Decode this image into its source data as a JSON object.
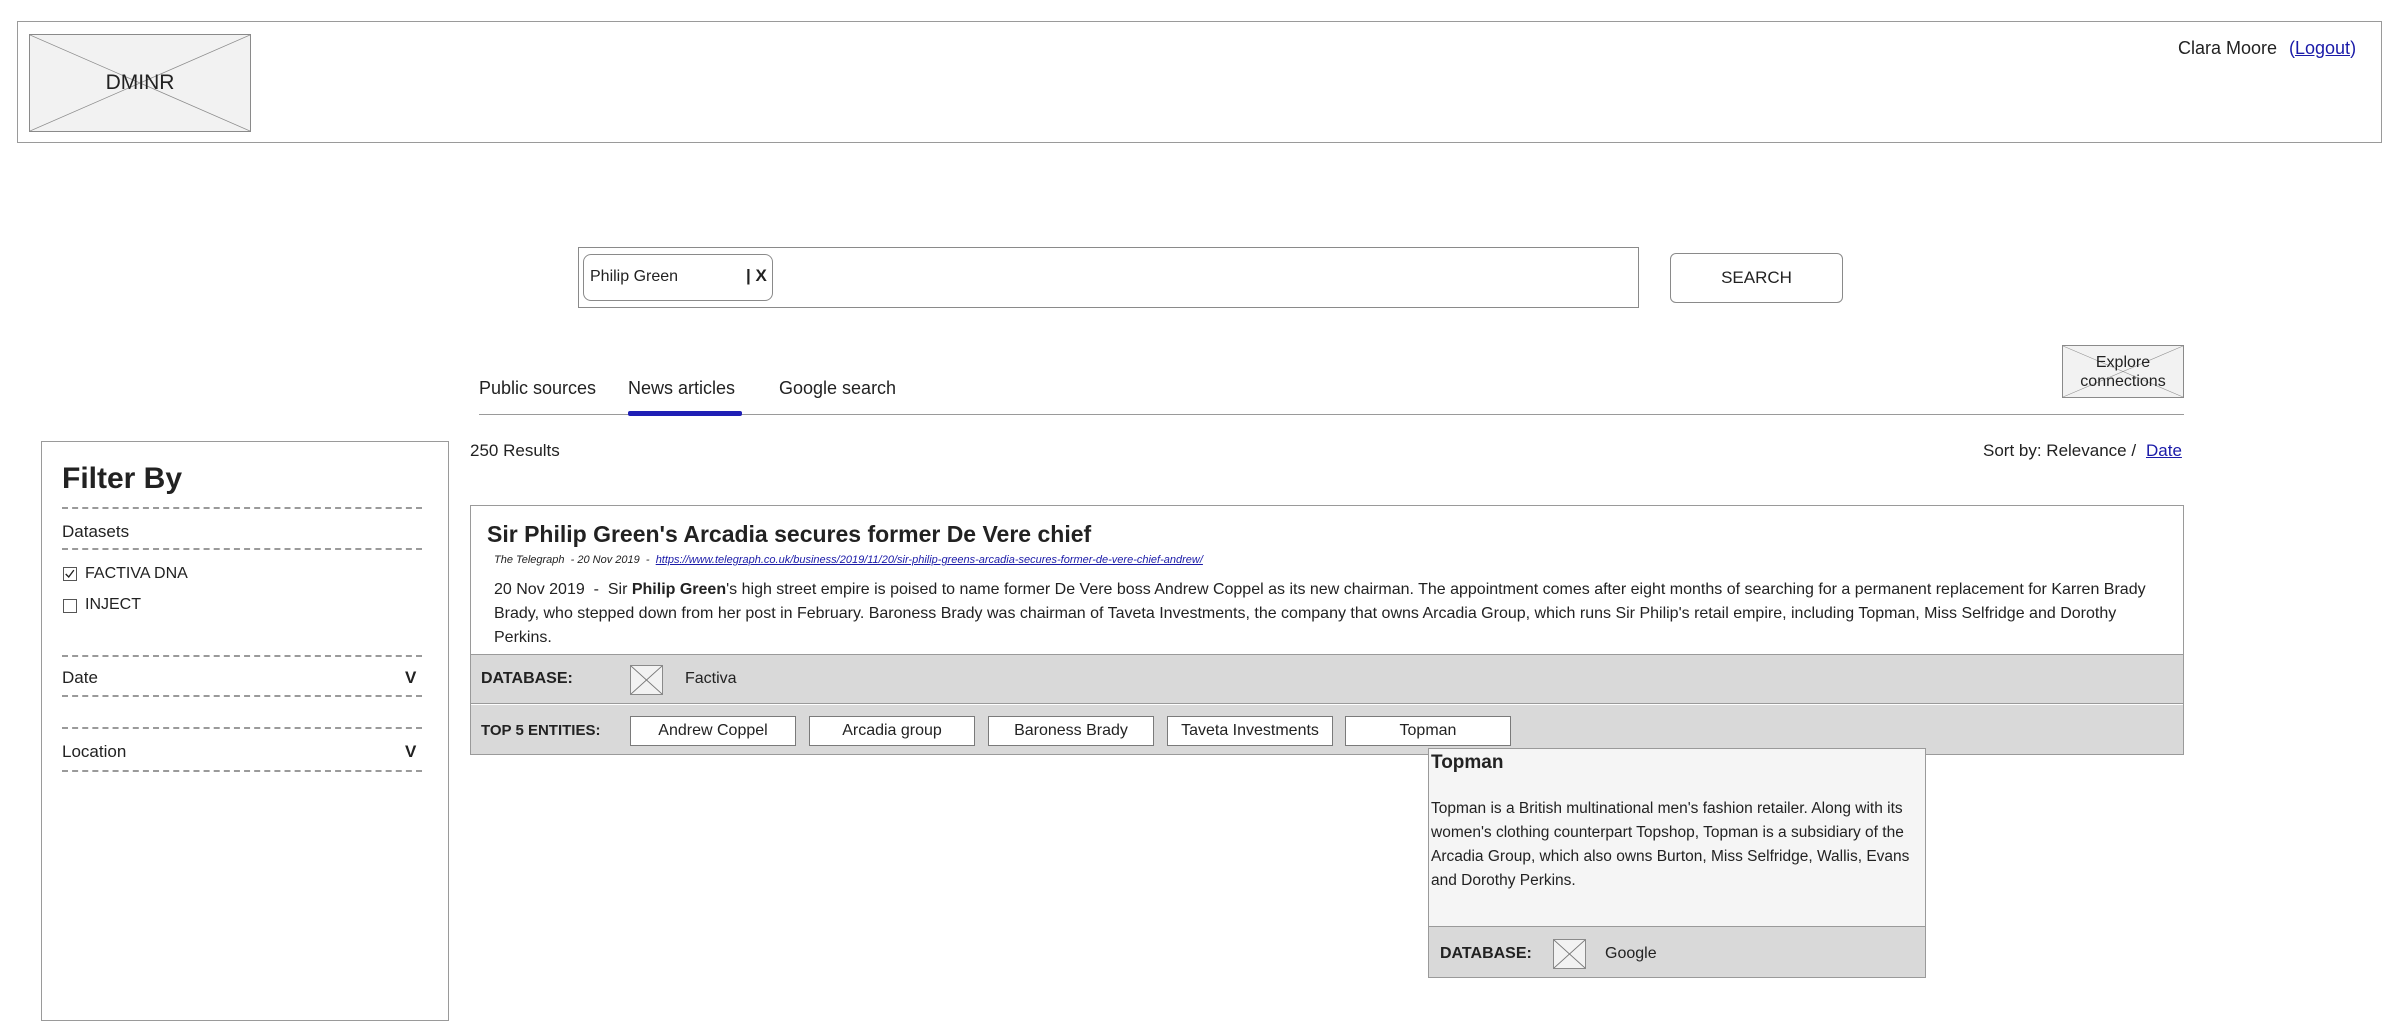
{
  "header": {
    "logo_text": "DMINR",
    "user_name": "Clara Moore",
    "logout_open": "(",
    "logout_label": "Logout",
    "logout_close": ")"
  },
  "search": {
    "chip_text": "Philip Green",
    "chip_clear": "| X",
    "button_label": "SEARCH"
  },
  "tabs": [
    {
      "label": "Public sources",
      "active": false
    },
    {
      "label": "News articles",
      "active": true
    },
    {
      "label": "Google search",
      "active": false
    }
  ],
  "explore_button": {
    "line1": "Explore",
    "line2": "connections"
  },
  "filter": {
    "title": "Filter By",
    "datasets_label": "Datasets",
    "datasets": [
      {
        "label": "FACTIVA DNA",
        "checked": true
      },
      {
        "label": "INJECT",
        "checked": false
      }
    ],
    "date_label": "Date",
    "location_label": "Location",
    "chevron": "V"
  },
  "results": {
    "count_text": "250 Results",
    "sort_label": "Sort by: Relevance /",
    "sort_date": "Date"
  },
  "article": {
    "title": "Sir Philip Green's Arcadia secures former De Vere chief",
    "source": "The Telegraph",
    "separator": " - ",
    "date": "20 Nov 2019",
    "url": "https://www.telegraph.co.uk/business/2019/11/20/sir-philip-greens-arcadia-secures-former-de-vere-chief-andrew/",
    "body_date": "20 Nov 2019",
    "body_lead": "Sir",
    "body_highlight": "Philip Green",
    "body_rest": "'s high street empire is poised to name former De Vere boss Andrew Coppel as its new chairman. The appointment comes after eight months of searching for a permanent replacement for Karren Brady Brady, who stepped down from her post in February. Baroness Brady was chairman of Taveta Investments, the company that owns Arcadia Group, which runs Sir Philip's retail empire, including Topman, Miss Selfridge and Dorothy Perkins.",
    "database_label": "DATABASE:",
    "database_value": "Factiva",
    "entities_label": "TOP 5 ENTITIES:",
    "entities": [
      "Andrew Coppel",
      "Arcadia group",
      "Baroness Brady",
      "Taveta Investments",
      "Topman"
    ]
  },
  "popup": {
    "title": "Topman",
    "description": "Topman is a British multinational men's fashion retailer. Along with its women's clothing counterpart Topshop, Topman is a subsidiary of the Arcadia Group, which also owns Burton, Miss Selfridge, Wallis, Evans and Dorothy Perkins.",
    "database_label": "DATABASE:",
    "database_value": "Google"
  },
  "colors": {
    "accent": "#1f1fb5",
    "strip": "#d9d9d9",
    "border": "#9a9a9a"
  }
}
